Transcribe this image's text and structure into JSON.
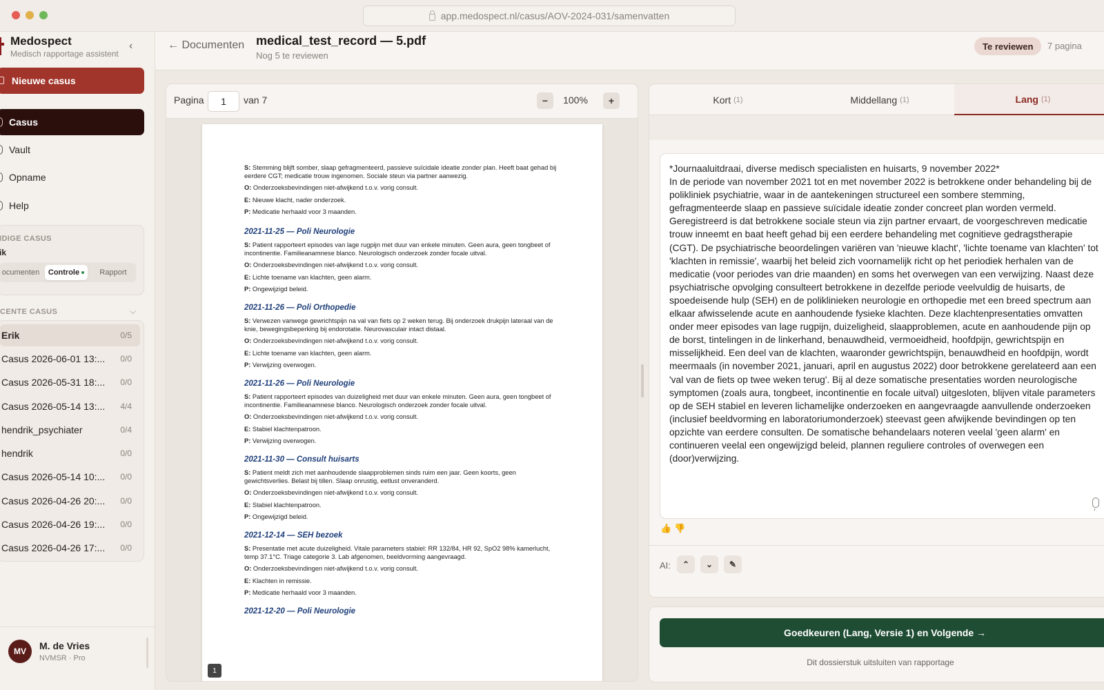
{
  "browser": {
    "url": "app.medospect.nl/casus/AOV-2024-031/samenvatten"
  },
  "sidebar": {
    "brand_name": "Medospect",
    "brand_subtitle": "Medisch rapportage assistent",
    "new_case_label": "Nieuwe casus",
    "nav": [
      {
        "label": "Casus",
        "active": true
      },
      {
        "label": "Vault"
      },
      {
        "label": "Opname"
      },
      {
        "label": "Help"
      }
    ],
    "current_case": {
      "section_label": "IDIGE CASUS",
      "name": "ik",
      "tabs": [
        "ocumenten",
        "Controle",
        "Rapport"
      ]
    },
    "recent_label": "CENTE CASUS",
    "recent": [
      {
        "name": "Erik",
        "count": "0/5"
      },
      {
        "name": "Casus 2026-06-01 13:...",
        "count": "0/0"
      },
      {
        "name": "Casus 2026-05-31 18:...",
        "count": "0/0"
      },
      {
        "name": "Casus 2026-05-14 13:...",
        "count": "4/4"
      },
      {
        "name": "hendrik_psychiater",
        "count": "0/4"
      },
      {
        "name": "hendrik",
        "count": "0/0"
      },
      {
        "name": "Casus 2026-05-14 10:...",
        "count": "0/0"
      },
      {
        "name": "Casus 2026-04-26 20:...",
        "count": "0/0"
      },
      {
        "name": "Casus 2026-04-26 19:...",
        "count": "0/0"
      },
      {
        "name": "Casus 2026-04-26 17:...",
        "count": "0/0"
      }
    ],
    "user": {
      "initials": "MV",
      "name": "M. de Vries",
      "role": "NVMSR · Pro"
    }
  },
  "header": {
    "back_label": "← Documenten",
    "doc_title": "medical_test_record — 5.pdf",
    "doc_subtitle": "Nog 5 te reviewen",
    "review_badge": "Te reviewen",
    "page_count": "7 pagina"
  },
  "viewer": {
    "page_label": "Pagina",
    "page_value": "1",
    "of_label": "van 7",
    "zoom_out": "−",
    "zoom": "100%",
    "zoom_in": "+",
    "page_marker": "1",
    "entries": [
      {
        "title": "",
        "lines": [
          {
            "key": "S:",
            "text": "Stemming blijft somber, slaap gefragmenteerd, passieve suïcidale ideatie zonder plan. Heeft baat gehad bij eerdere CGT; medicatie trouw ingenomen. Sociale steun via partner aanwezig."
          },
          {
            "key": "O:",
            "text": "Onderzoeksbevindingen niet-afwijkend t.o.v. vorig consult."
          },
          {
            "key": "E:",
            "text": "Nieuwe klacht, nader onderzoek."
          },
          {
            "key": "P:",
            "text": "Medicatie herhaald voor 3 maanden."
          }
        ]
      },
      {
        "title": "2021-11-25 — Poli Neurologie",
        "lines": [
          {
            "key": "S:",
            "text": "Patient rapporteert episodes van lage rugpijn met duur van enkele minuten. Geen aura, geen tongbeet of incontinentie. Familieanamnese blanco. Neurologisch onderzoek zonder focale uitval."
          },
          {
            "key": "O:",
            "text": "Onderzoeksbevindingen niet-afwijkend t.o.v. vorig consult."
          },
          {
            "key": "E:",
            "text": "Lichte toename van klachten, geen alarm."
          },
          {
            "key": "P:",
            "text": "Ongewijzigd beleid."
          }
        ]
      },
      {
        "title": "2021-11-26 — Poli Orthopedie",
        "lines": [
          {
            "key": "S:",
            "text": "Verwezen vanwege gewrichtspijn na val van fiets op 2 weken terug. Bij onderzoek drukpijn lateraal van de knie, bewegingsbeperking bij endorotatie. Neurovasculair intact distaal."
          },
          {
            "key": "O:",
            "text": "Onderzoeksbevindingen niet-afwijkend t.o.v. vorig consult."
          },
          {
            "key": "E:",
            "text": "Lichte toename van klachten, geen alarm."
          },
          {
            "key": "P:",
            "text": "Verwijzing overwogen."
          }
        ]
      },
      {
        "title": "2021-11-26 — Poli Neurologie",
        "lines": [
          {
            "key": "S:",
            "text": "Patient rapporteert episodes van duizeligheid met duur van enkele minuten. Geen aura, geen tongbeet of incontinentie. Familieanamnese blanco. Neurologisch onderzoek zonder focale uitval."
          },
          {
            "key": "O:",
            "text": "Onderzoeksbevindingen niet-afwijkend t.o.v. vorig consult."
          },
          {
            "key": "E:",
            "text": "Stabiel klachtenpatroon."
          },
          {
            "key": "P:",
            "text": "Verwijzing overwogen."
          }
        ]
      },
      {
        "title": "2021-11-30 — Consult huisarts",
        "lines": [
          {
            "key": "S:",
            "text": "Patient meldt zich met aanhoudende slaapproblemen sinds ruim een jaar. Geen koorts, geen gewichtsverlies. Belast bij tillen. Slaap onrustig, eetlust onveranderd."
          },
          {
            "key": "O:",
            "text": "Onderzoeksbevindingen niet-afwijkend t.o.v. vorig consult."
          },
          {
            "key": "E:",
            "text": "Stabiel klachtenpatroon."
          },
          {
            "key": "P:",
            "text": "Ongewijzigd beleid."
          }
        ]
      },
      {
        "title": "2021-12-14 — SEH bezoek",
        "lines": [
          {
            "key": "S:",
            "text": "Presentatie met acute duizeligheid. Vitale parameters stabiel: RR 132/84, HR 92, SpO2 98% kamerlucht, temp 37.1°C. Triage categorie 3. Lab afgenomen, beeldvorming aangevraagd."
          },
          {
            "key": "O:",
            "text": "Onderzoeksbevindingen niet-afwijkend t.o.v. vorig consult."
          },
          {
            "key": "E:",
            "text": "Klachten in remissie."
          },
          {
            "key": "P:",
            "text": "Medicatie herhaald voor 3 maanden."
          }
        ]
      },
      {
        "title": "2021-12-20 — Poli Neurologie",
        "lines": []
      }
    ]
  },
  "summary": {
    "tabs": [
      {
        "label": "Kort",
        "count": "(1)"
      },
      {
        "label": "Middellang",
        "count": "(1)"
      },
      {
        "label": "Lang",
        "count": "(1)"
      }
    ],
    "active_tab": 2,
    "text_heading": "*Journaaluitdraai, diverse medisch specialisten en huisarts, 9 november 2022*",
    "text_body": "In de periode van november 2021 tot en met november 2022 is betrokkene onder behandeling bij de polikliniek psychiatrie, waar in de aantekeningen structureel een sombere stemming, gefragmenteerde slaap en passieve suïcidale ideatie zonder concreet plan worden vermeld. Geregistreerd is dat betrokkene sociale steun via zijn partner ervaart, de voorgeschreven medicatie trouw inneemt en baat heeft gehad bij een eerdere behandeling met cognitieve gedragstherapie (CGT). De psychiatrische beoordelingen variëren van 'nieuwe klacht', 'lichte toename van klachten' tot 'klachten in remissie', waarbij het beleid zich voornamelijk richt op het periodiek herhalen van de medicatie (voor periodes van drie maanden) en soms het overwegen van een verwijzing. Naast deze psychiatrische opvolging consulteert betrokkene in dezelfde periode veelvuldig de huisarts, de spoedeisende hulp (SEH) en de poliklinieken neurologie en orthopedie met een breed spectrum aan elkaar afwisselende acute en aanhoudende fysieke klachten. Deze klachtenpresentaties omvatten onder meer episodes van lage rugpijn, duizeligheid, slaapproblemen, acute en aanhoudende pijn op de borst, tintelingen in de linkerhand, benauwdheid, vermoeidheid, hoofdpijn, gewrichtspijn en misselijkheid. Een deel van de klachten, waaronder gewrichtspijn, benauwdheid en hoofdpijn, wordt meermaals (in november 2021, januari, april en augustus 2022) door betrokkene gerelateerd aan een 'val van de fiets op twee weken terug'. Bij al deze somatische presentaties worden neurologische symptomen (zoals aura, tongbeet, incontinentie en focale uitval) uitgesloten, blijven vitale parameters op de SEH stabiel en leveren lichamelijke onderzoeken en aangevraagde aanvullende onderzoeken (inclusief beeldvorming en laboratoriumonderzoek) steevast geen afwijkende bevindingen op ten opzichte van eerdere consulten. De somatische behandelaars noteren veelal 'geen alarm' en continueren veelal een ongewijzigd beleid, plannen reguliere controles of overwegen een (door)verwijzing.",
    "ai_label": "AI:",
    "ai_actions": [
      "⌃",
      "⌄",
      "✎"
    ],
    "approve_label": "Goedkeuren (Lang, Versie 1) en Volgende →",
    "exclude_label": "Dit dossierstuk uitsluiten van rapportage"
  },
  "colors": {
    "brand": "#a1352b",
    "active_nav": "#2a0f0d",
    "approve": "#1f4d34",
    "accent_tab": "#8b2a22"
  }
}
